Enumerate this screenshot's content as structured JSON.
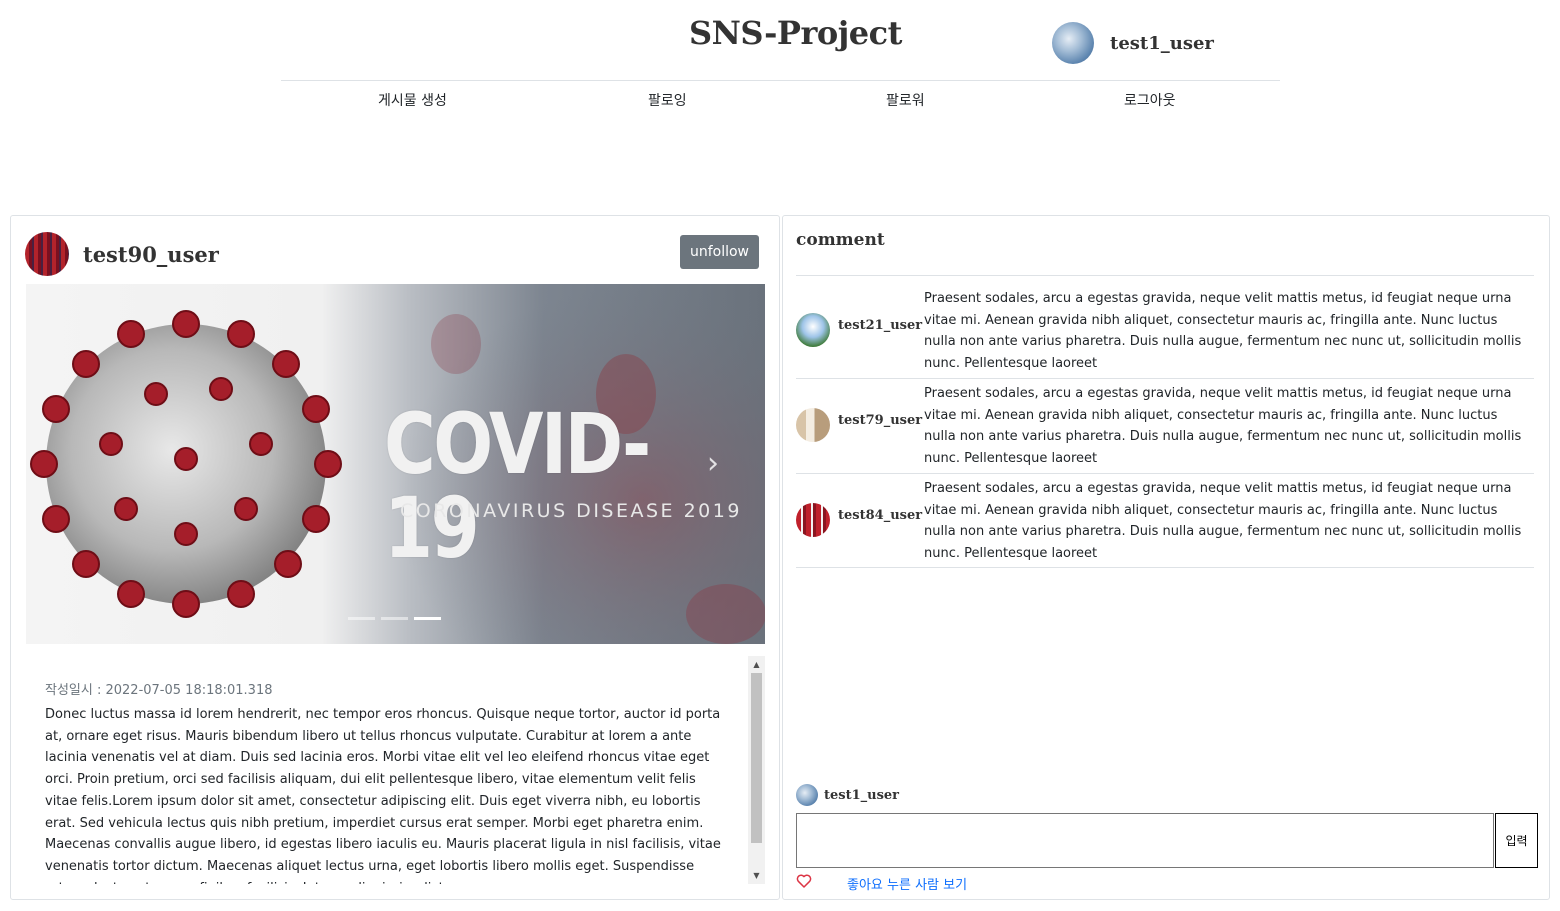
{
  "header": {
    "brand": "SNS-Project",
    "current_user": "test1_user"
  },
  "nav": {
    "items": [
      {
        "label": "게시물 생성"
      },
      {
        "label": "팔로잉"
      },
      {
        "label": "팔로워"
      },
      {
        "label": "로그아웃"
      }
    ]
  },
  "post": {
    "author": "test90_user",
    "follow_button": "unfollow",
    "image": {
      "headline": "COVID-19",
      "subline": "CORONAVIRUS DISEASE 2019",
      "slide_count": 3,
      "active_slide": 3
    },
    "date": "작성일시 : 2022-07-05 18:18:01.318",
    "content": "Donec luctus massa id lorem hendrerit, nec tempor eros rhoncus. Quisque neque tortor, auctor id porta at, ornare eget risus. Mauris bibendum libero ut tellus rhoncus vulputate. Curabitur at lorem a ante lacinia venenatis vel at diam. Duis sed lacinia eros. Morbi vitae elit vel leo eleifend rhoncus vitae eget orci. Proin pretium, orci sed facilisis aliquam, dui elit pellentesque libero, vitae elementum velit felis vitae felis.Lorem ipsum dolor sit amet, consectetur adipiscing elit. Duis eget viverra nibh, eu lobortis erat. Sed vehicula lectus quis nibh pretium, imperdiet cursus erat semper. Morbi eget pharetra enim. Maecenas convallis augue libero, id egestas libero iaculis eu. Mauris placerat ligula in nisl facilisis, vitae venenatis tortor dictum. Maecenas aliquet lectus urna, eget lobortis libero mollis eget. Suspendisse rutrum lectus ut augue finibus facilisis. Integer dignissim dictum."
  },
  "comments": {
    "title": "comment",
    "items": [
      {
        "user": "test21_user",
        "text": "Praesent sodales, arcu a egestas gravida, neque velit mattis metus, id feugiat neque urna vitae mi. Aenean gravida nibh aliquet, consectetur mauris ac, fringilla ante. Nunc luctus nulla non ante varius pharetra. Duis nulla augue, fermentum nec nunc ut, sollicitudin mollis nunc. Pellentesque laoreet"
      },
      {
        "user": "test79_user",
        "text": "Praesent sodales, arcu a egestas gravida, neque velit mattis metus, id feugiat neque urna vitae mi. Aenean gravida nibh aliquet, consectetur mauris ac, fringilla ante. Nunc luctus nulla non ante varius pharetra. Duis nulla augue, fermentum nec nunc ut, sollicitudin mollis nunc. Pellentesque laoreet"
      },
      {
        "user": "test84_user",
        "text": "Praesent sodales, arcu a egestas gravida, neque velit mattis metus, id feugiat neque urna vitae mi. Aenean gravida nibh aliquet, consectetur mauris ac, fringilla ante. Nunc luctus nulla non ante varius pharetra. Duis nulla augue, fermentum nec nunc ut, sollicitudin mollis nunc. Pellentesque laoreet"
      }
    ],
    "writer": "test1_user",
    "input_value": "",
    "submit_label": "입력",
    "likes_link": "좋아요 누른 사람 보기"
  },
  "icons": {
    "heart": "heart-outline-icon",
    "next": "chevron-right-icon"
  },
  "colors": {
    "follow_button_bg": "#6c757d",
    "link": "#0d6efd",
    "heart": "#dc3545"
  }
}
